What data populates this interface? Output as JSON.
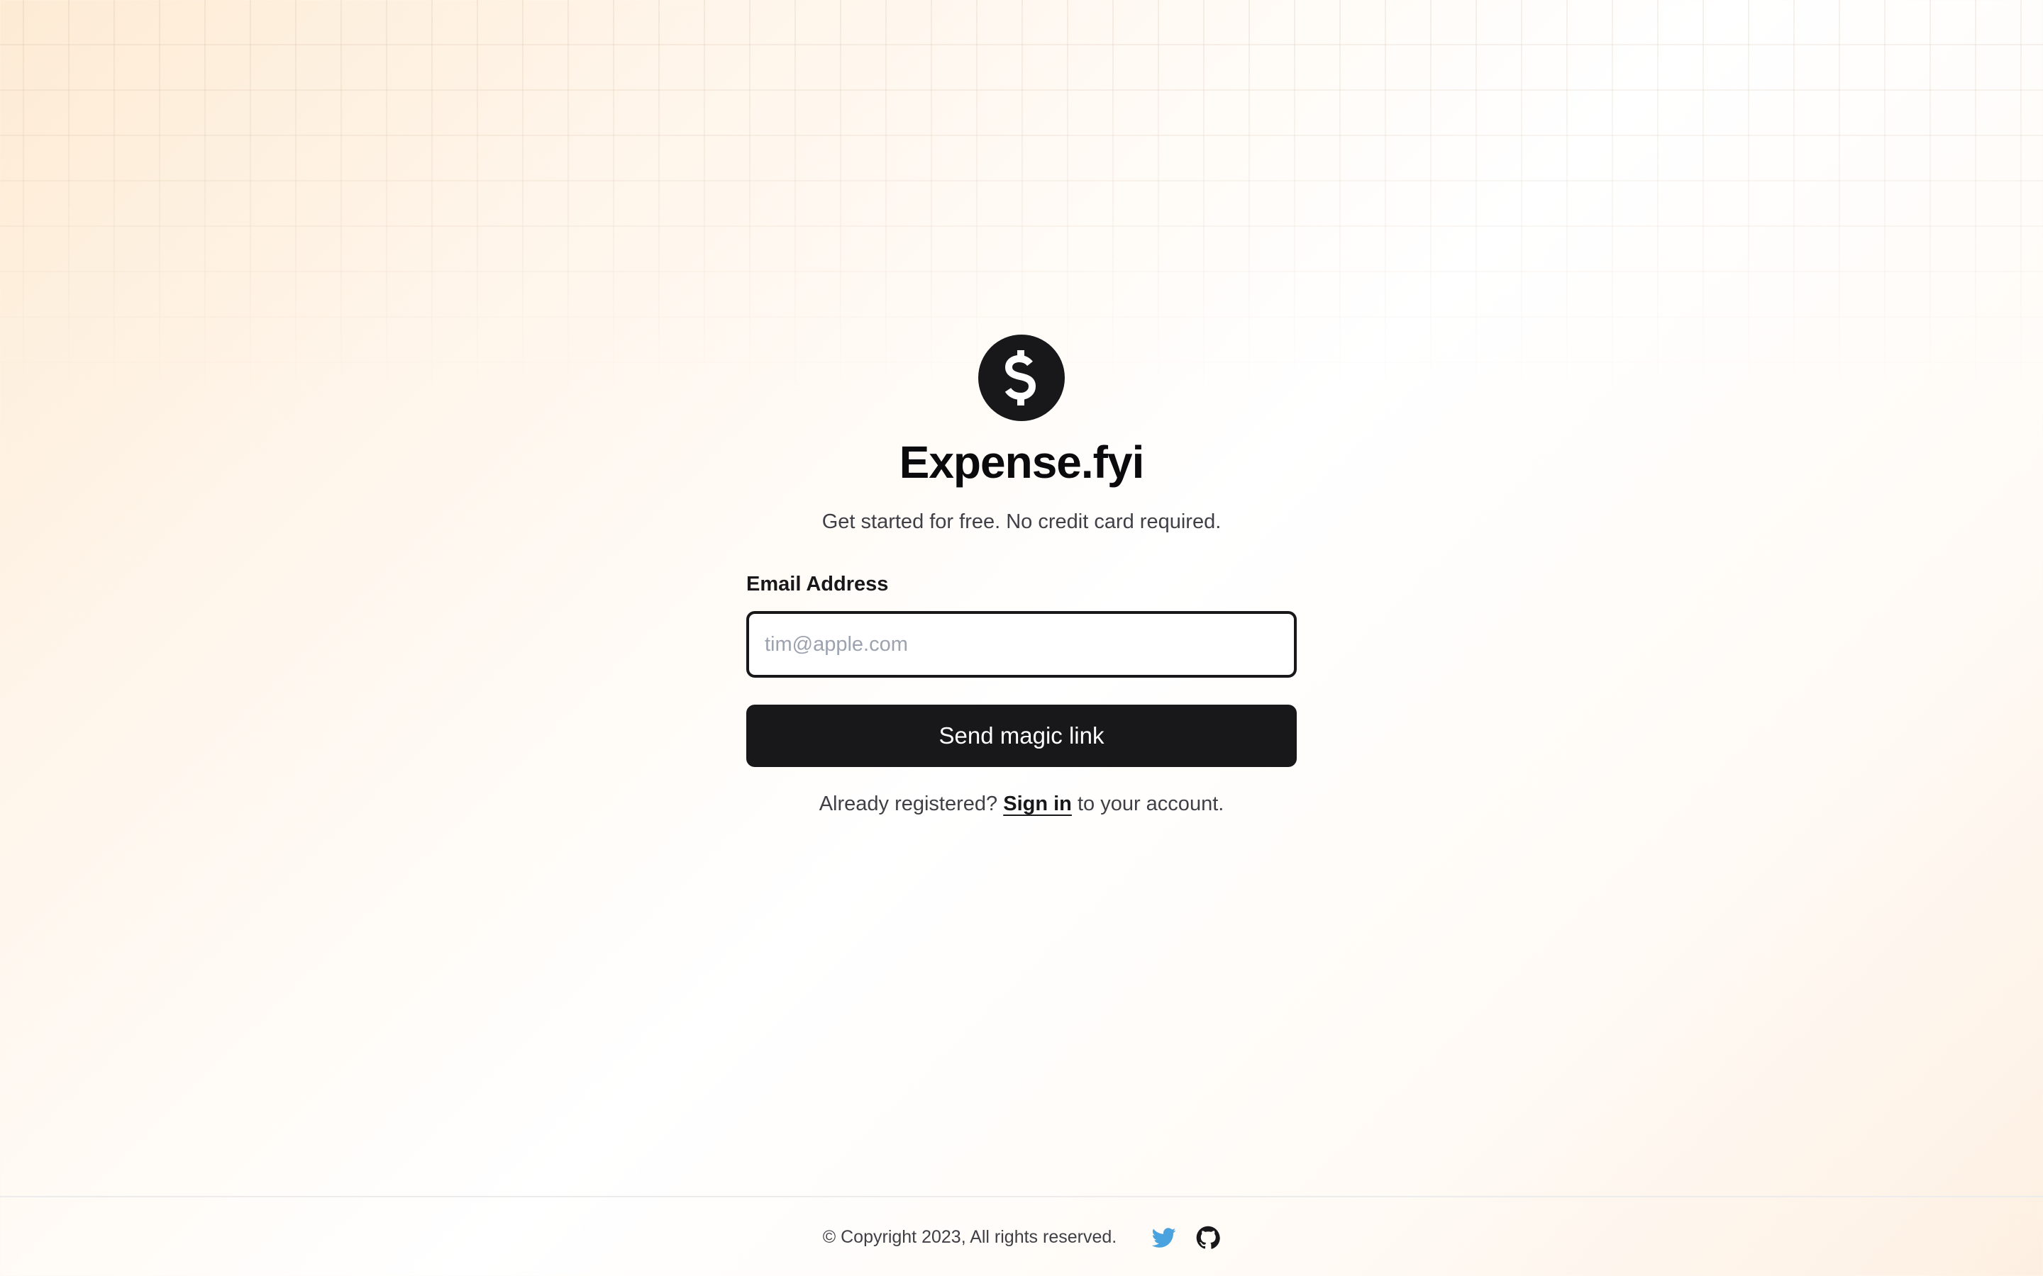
{
  "brand": {
    "name": "Expense.fyi",
    "logo_icon": "dollar-icon",
    "tagline": "Get started for free. No credit card required."
  },
  "form": {
    "email_label": "Email Address",
    "email_placeholder": "tim@apple.com",
    "email_value": "",
    "submit_label": "Send magic link"
  },
  "signin": {
    "prefix": "Already registered?",
    "link_label": "Sign in",
    "suffix": "to your account."
  },
  "footer": {
    "copyright": "© Copyright 2023, All rights reserved.",
    "social": [
      {
        "icon": "twitter-icon",
        "color": "#4aa3df"
      },
      {
        "icon": "github-icon",
        "color": "#18181b"
      }
    ]
  },
  "colors": {
    "primary": "#18181b",
    "background_tint": "#fdebd4",
    "twitter": "#4aa3df"
  }
}
